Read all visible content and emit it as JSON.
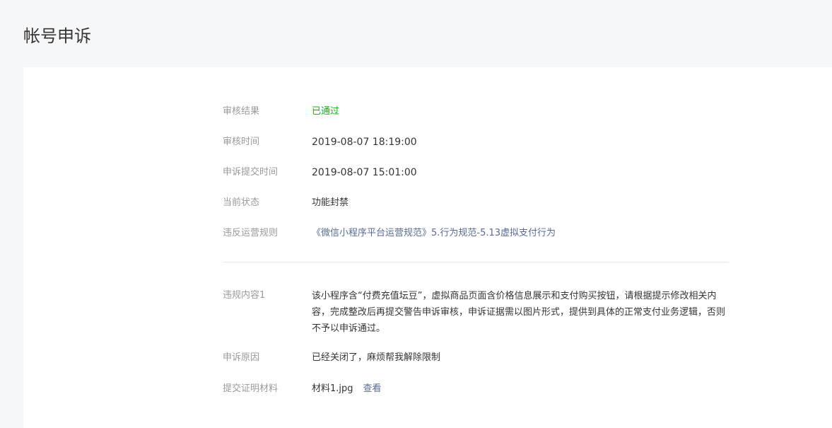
{
  "page": {
    "title": "帐号申诉"
  },
  "review_result": {
    "label": "审核结果",
    "value": "已通过"
  },
  "review_time": {
    "label": "审核时间",
    "value": "2019-08-07 18:19:00"
  },
  "submit_time": {
    "label": "申诉提交时间",
    "value": "2019-08-07 15:01:00"
  },
  "current_status": {
    "label": "当前状态",
    "value": "功能封禁"
  },
  "violated_rule": {
    "label": "违反运营规则",
    "value": "《微信小程序平台运营规范》5.行为规范-5.13虚拟支付行为"
  },
  "violation_content": {
    "label": "违规内容1",
    "value": "该小程序含“付费充值坛豆”，虚拟商品页面含价格信息展示和支付购买按钮，请根据提示修改相关内容，完成整改后再提交警告申诉审核，申诉证据需以图片形式，提供到具体的正常支付业务逻辑，否则不予以申诉通过。"
  },
  "appeal_reason": {
    "label": "申诉原因",
    "value": "已经关闭了，麻烦帮我解除限制"
  },
  "evidence": {
    "label": "提交证明材料",
    "filename": "材料1.jpg",
    "view_label": "查看"
  },
  "colors": {
    "success": "#09bb07",
    "link": "#576b95",
    "label": "#9a9a9a",
    "text": "#353535",
    "background": "#f6f7f9"
  }
}
